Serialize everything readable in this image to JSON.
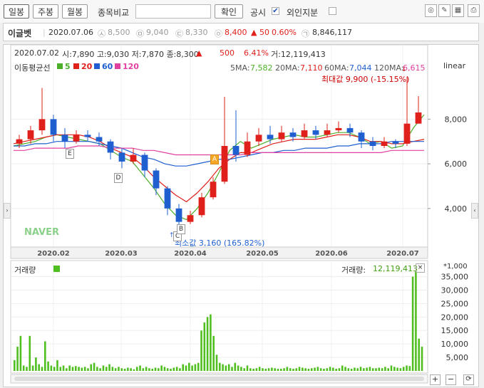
{
  "toolbar": {
    "tabs": [
      "일봉",
      "주봉",
      "월봉"
    ],
    "compare_label": "종목비교",
    "confirm_label": "확인",
    "disclosure_label": "공시",
    "foreign_label": "외인지분"
  },
  "stock": {
    "name": "이글벳",
    "date": "2020.07.06",
    "open": "8,500",
    "high": "9,040",
    "low": "8,330",
    "close": "8,400",
    "change": "▲ 50",
    "change_pct": "0.60%",
    "volume": "8,846,117"
  },
  "chart_header": {
    "date": "2020.07.02",
    "ohlc_text": "시:7,890  고:9,030  저:7,870  종:8,300",
    "arrow": "▲",
    "change": "500",
    "change_pct": "6.41%",
    "volume_text": "거:12,119,413"
  },
  "legend": {
    "title": "이동평균선",
    "ma5": "5",
    "ma20": "20",
    "ma60": "60",
    "ma120": "120",
    "scale": "linear"
  },
  "ma_values": {
    "ma5_label": "5MA:",
    "ma5": "7,582",
    "ma20_label": "20MA:",
    "ma20": "7,110",
    "ma60_label": "60MA:",
    "ma60": "7,044",
    "ma120_label": "120MA:",
    "ma120": "6,615"
  },
  "annotations": {
    "max": "최대값 9,900 (-15.15%)",
    "min": "최소값 3,160 (165.82%)",
    "markers": [
      "E",
      "D",
      "C",
      "B",
      "A"
    ],
    "brand": "NAVER"
  },
  "volume_panel": {
    "title": "거래량",
    "value_label": "거래량:",
    "value": "12,119,413",
    "unit": "*1,000"
  },
  "colors": {
    "up": "#e0201b",
    "down": "#1f5fd0",
    "ma5": "#4caf2a",
    "ma20": "#e0201b",
    "ma60": "#1f5fd0",
    "ma120": "#e040a0",
    "volume": "#4fbf20"
  },
  "chart_data": {
    "type": "candlestick",
    "price_axis": {
      "ticks": [
        "8,000",
        "6,000",
        "4,000"
      ],
      "range": [
        2400,
        11200
      ]
    },
    "x_ticks": [
      "2020.02",
      "2020.03",
      "2020.04",
      "2020.05",
      "2020.06",
      "2020.07"
    ],
    "series": [
      {
        "name": "5",
        "values": [
          6800,
          6900,
          7000,
          7200,
          7300,
          7200,
          7100,
          7000,
          6900,
          6600,
          6300,
          6100,
          5500,
          4900,
          4200,
          3700,
          3500,
          4000,
          4700,
          5600,
          6600,
          7000,
          6700,
          6900,
          7100,
          7200,
          7300,
          7200,
          7200,
          7300,
          7400,
          7400,
          7200,
          6900,
          7000,
          6700,
          6800,
          7600,
          8200
        ]
      },
      {
        "name": "20",
        "values": [
          6900,
          7000,
          7100,
          7200,
          7300,
          7300,
          7300,
          7200,
          7000,
          6700,
          6500,
          6300,
          5900,
          5400,
          5000,
          4600,
          4300,
          4700,
          5200,
          5800,
          6200,
          6500,
          6500,
          6700,
          6900,
          7000,
          7100,
          7100,
          7100,
          7200,
          7300,
          7300,
          7200,
          7000,
          7000,
          6900,
          6900,
          7000,
          7100
        ]
      },
      {
        "name": "60",
        "values": [
          6800,
          6800,
          6900,
          6900,
          7000,
          7000,
          7000,
          7000,
          6900,
          6800,
          6700,
          6500,
          6300,
          6200,
          6000,
          5900,
          5900,
          6000,
          6100,
          6200,
          6200,
          6300,
          6400,
          6500,
          6500,
          6600,
          6600,
          6700,
          6700,
          6700,
          6800,
          6800,
          6900,
          6900,
          6900,
          7000,
          7000,
          7000,
          7000
        ]
      },
      {
        "name": "120",
        "values": [
          6600,
          6600,
          6700,
          6700,
          6700,
          6700,
          6800,
          6800,
          6800,
          6700,
          6700,
          6700,
          6600,
          6600,
          6500,
          6400,
          6400,
          6400,
          6400,
          6400,
          6400,
          6400,
          6500,
          6500,
          6500,
          6500,
          6500,
          6500,
          6500,
          6500,
          6500,
          6500,
          6500,
          6500,
          6500,
          6600,
          6600,
          6600,
          6600
        ]
      }
    ],
    "candles": [
      [
        6900,
        7100,
        7300,
        6700
      ],
      [
        7100,
        7500,
        7700,
        6900
      ],
      [
        7500,
        8000,
        9400,
        7300
      ],
      [
        8000,
        7300,
        8200,
        7000
      ],
      [
        7300,
        7000,
        7600,
        6700
      ],
      [
        7000,
        7300,
        7500,
        6900
      ],
      [
        7300,
        7200,
        7500,
        7000
      ],
      [
        7200,
        7000,
        7400,
        6800
      ],
      [
        7000,
        6500,
        7100,
        6200
      ],
      [
        6500,
        6100,
        6700,
        5800
      ],
      [
        6100,
        6400,
        6700,
        6000
      ],
      [
        6400,
        5700,
        6500,
        5400
      ],
      [
        5700,
        4900,
        5800,
        4600
      ],
      [
        4900,
        4000,
        5000,
        3700
      ],
      [
        4000,
        3400,
        4200,
        3160
      ],
      [
        3400,
        3700,
        3900,
        3300
      ],
      [
        3700,
        4500,
        4700,
        3600
      ],
      [
        4500,
        5200,
        5400,
        4400
      ],
      [
        5200,
        6800,
        9000,
        5100
      ],
      [
        6800,
        6400,
        8400,
        6100
      ],
      [
        6400,
        7000,
        7400,
        6300
      ],
      [
        7000,
        7300,
        7600,
        6800
      ],
      [
        7300,
        7100,
        7700,
        6900
      ],
      [
        7100,
        7400,
        7700,
        7000
      ],
      [
        7400,
        7200,
        7600,
        7000
      ],
      [
        7200,
        7500,
        7800,
        7100
      ],
      [
        7500,
        7300,
        7700,
        7100
      ],
      [
        7300,
        7500,
        7800,
        7200
      ],
      [
        7500,
        7600,
        7900,
        7400
      ],
      [
        7600,
        7400,
        7800,
        7200
      ],
      [
        7400,
        7000,
        7500,
        6700
      ],
      [
        7000,
        6800,
        7200,
        6600
      ],
      [
        6800,
        7000,
        7200,
        6700
      ],
      [
        7000,
        6900,
        7100,
        6700
      ],
      [
        6900,
        7800,
        9900,
        6800
      ],
      [
        7800,
        8300,
        9030,
        7800
      ]
    ],
    "volume_axis": {
      "ticks": [
        "35,000",
        "30,000",
        "25,000",
        "20,000",
        "15,000",
        "10,000",
        "5,000"
      ],
      "max": 37000
    },
    "volumes": [
      4000,
      9000,
      13000,
      2000,
      1500,
      13000,
      2000,
      5000,
      2500,
      1500,
      11000,
      3500,
      2000,
      1500,
      4000,
      1500,
      2000,
      1000,
      2000,
      1500,
      1800,
      1500,
      1200,
      1500,
      1000,
      2500,
      3000,
      1500,
      1000,
      2000,
      1500,
      2500,
      1500,
      1000,
      1500,
      1000,
      800,
      1200,
      1000,
      600,
      1500,
      2000,
      1000,
      1500,
      1000,
      800,
      1200,
      1000,
      2000,
      1500,
      1000,
      800,
      1200,
      1500,
      1000,
      2500,
      2000,
      3000,
      2000,
      2500,
      3000,
      15000,
      18000,
      20000,
      21000,
      13000,
      6000,
      3000,
      2500,
      2000,
      2500,
      1500,
      3000,
      2000,
      1500,
      1000,
      2000,
      1000,
      800,
      1000,
      1500,
      1000,
      800,
      1000,
      1200,
      1000,
      800,
      800,
      1000,
      1500,
      1000,
      800,
      1000,
      1500,
      1200,
      1000,
      800,
      1000,
      1200,
      1500,
      1000,
      800,
      1000,
      1500,
      1200,
      800,
      1000,
      2000,
      1500,
      1000,
      800,
      1200,
      1000,
      1500,
      1000,
      1200,
      1500,
      1000,
      1000,
      1200,
      1000,
      1500,
      1000,
      2000,
      1500,
      1200,
      1000,
      1500,
      2000,
      1800,
      35000,
      37000,
      12000,
      9000
    ]
  }
}
